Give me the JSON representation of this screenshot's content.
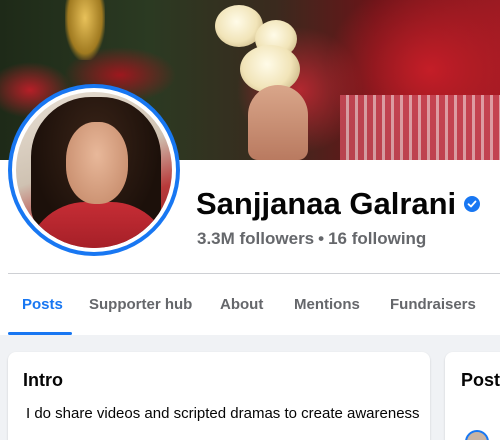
{
  "profile": {
    "name": "Sanjjanaa Galrani",
    "followers": "3.3M followers",
    "separator": "•",
    "following": "16 following",
    "verified": true
  },
  "tabs": [
    {
      "label": "Posts",
      "active": true
    },
    {
      "label": "Supporter hub",
      "active": false
    },
    {
      "label": "About",
      "active": false
    },
    {
      "label": "Mentions",
      "active": false
    },
    {
      "label": "Fundraisers",
      "active": false
    }
  ],
  "intro": {
    "title": "Intro",
    "bio": "I do share videos and scripted dramas to create awareness"
  },
  "posts_card": {
    "title": "Post"
  },
  "colors": {
    "accent": "#1877f2",
    "text": "#050505",
    "secondary_text": "#65676b",
    "page_bg": "#f0f2f5"
  },
  "icons": {
    "verified": "verified-check-icon"
  }
}
